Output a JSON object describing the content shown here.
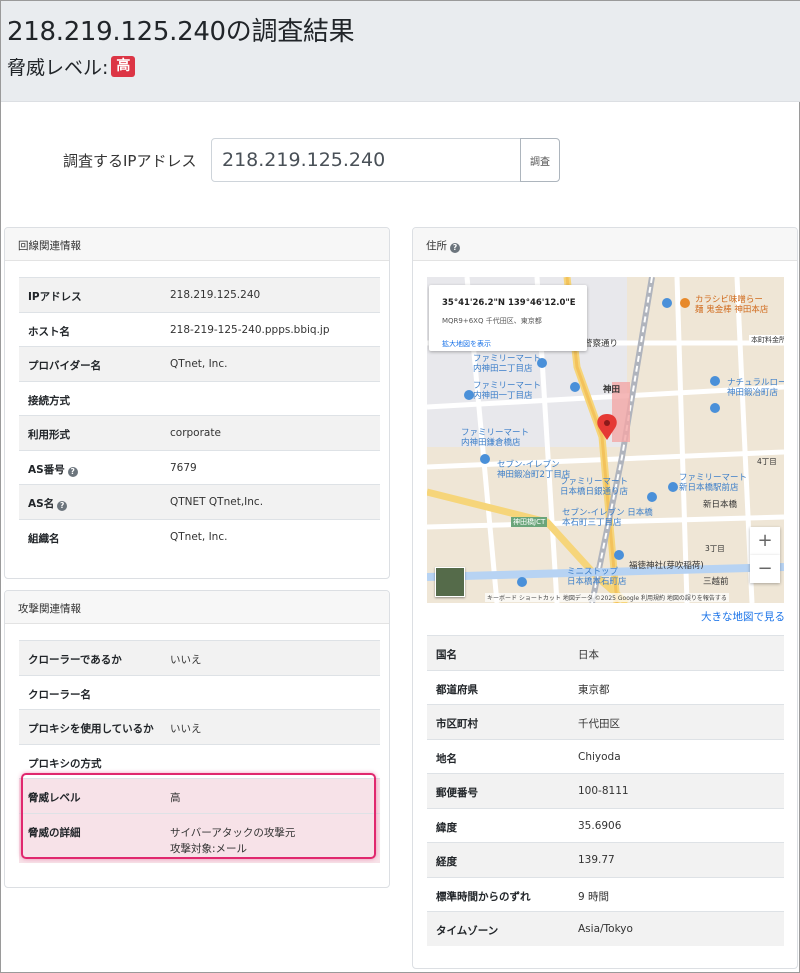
{
  "header": {
    "title": "218.219.125.240の調査結果",
    "threat_label": "脅威レベル:",
    "threat_badge": "高"
  },
  "search": {
    "label": "調査するIPアドレス",
    "value": "218.219.125.240",
    "button": "調査"
  },
  "line_info": {
    "header": "回線関連情報",
    "rows": [
      {
        "key": "IPアドレス",
        "value": "218.219.125.240"
      },
      {
        "key": "ホスト名",
        "value": "218-219-125-240.ppps.bbiq.jp"
      },
      {
        "key": "プロバイダー名",
        "value": "QTnet, Inc."
      },
      {
        "key": "接続方式",
        "value": ""
      },
      {
        "key": "利用形式",
        "value": "corporate"
      },
      {
        "key": "AS番号",
        "value": "7679"
      },
      {
        "key": "AS名",
        "value": "QTNET QTnet,Inc."
      },
      {
        "key": "組織名",
        "value": "QTnet, Inc."
      }
    ]
  },
  "attack_info": {
    "header": "攻撃関連情報",
    "rows": [
      {
        "key": "クローラーであるか",
        "value": "いいえ"
      },
      {
        "key": "クローラー名",
        "value": ""
      },
      {
        "key": "プロキシを使用しているか",
        "value": "いいえ"
      },
      {
        "key": "プロキシの方式",
        "value": ""
      },
      {
        "key": "脅威レベル",
        "value": "高"
      },
      {
        "key": "脅威の詳細",
        "value": "サイバーアタックの攻撃元",
        "value2": "攻撃対象:メール"
      }
    ]
  },
  "address": {
    "header": "住所",
    "map": {
      "coords": "35°41'26.2\"N 139°46'12.0\"E",
      "plus_code": "MQR9+6XQ 千代田区、東京都",
      "view_larger": "拡大地図を表示",
      "zoom_in": "+",
      "zoom_out": "−",
      "attribution": "キーボード ショートカット   地図データ ©2025 Google   利用規約   地図の誤りを報告する",
      "labels": {
        "famima1": "ファミリーマート",
        "famima1b": "内神田二丁目店",
        "famima2": "ファミリーマート",
        "famima2b": "内神田一丁目店",
        "famima3": "ファミリーマート",
        "famima3b": "内神田鎌倉橋店",
        "seven1": "セブン-イレブン",
        "seven1b": "神田鍛冶町2丁目店",
        "famima4": "ファミリーマート",
        "famima4b": "日本橋日銀通り店",
        "seven2": "セブン-イレブン 日本橋",
        "seven2b": "本石町三丁目店",
        "ministop": "ミニストップ",
        "ministopb": "日本橋本石町店",
        "karaoke": "カラシビ味噌らー",
        "karaokeb": "麺 鬼金棒 神田本店",
        "lawson": "ナチュラルローソン",
        "lawsonb": "神田鍛冶町店",
        "famima5": "ファミリーマート",
        "famima5b": "新日本橋駅前店",
        "kanda": "神田",
        "kanda_police": "神田警察通り",
        "mitsukoshi": "三越前",
        "fukutoku": "福徳神社(芽吹稲荷)",
        "shin_nihonbashi": "新日本橋",
        "kandabashi": "神田橋JCT",
        "honmachi": "本町料金所",
        "chome4": "4丁目",
        "chome3": "3丁目"
      }
    },
    "larger_map": "大きな地図で見る",
    "rows": [
      {
        "key": "国名",
        "value": "日本"
      },
      {
        "key": "都道府県",
        "value": "東京都"
      },
      {
        "key": "市区町村",
        "value": "千代田区"
      },
      {
        "key": "地名",
        "value": "Chiyoda"
      },
      {
        "key": "郵便番号",
        "value": "100-8111"
      },
      {
        "key": "緯度",
        "value": "35.6906"
      },
      {
        "key": "経度",
        "value": "139.77"
      },
      {
        "key": "標準時間からのずれ",
        "value": "9 時間"
      },
      {
        "key": "タイムゾーン",
        "value": "Asia/Tokyo"
      }
    ]
  },
  "colors": {
    "badge": "#dc3545",
    "highlight_border": "#e0286e",
    "highlight_fill": "#f7e2e8",
    "link": "#1a73e8"
  }
}
